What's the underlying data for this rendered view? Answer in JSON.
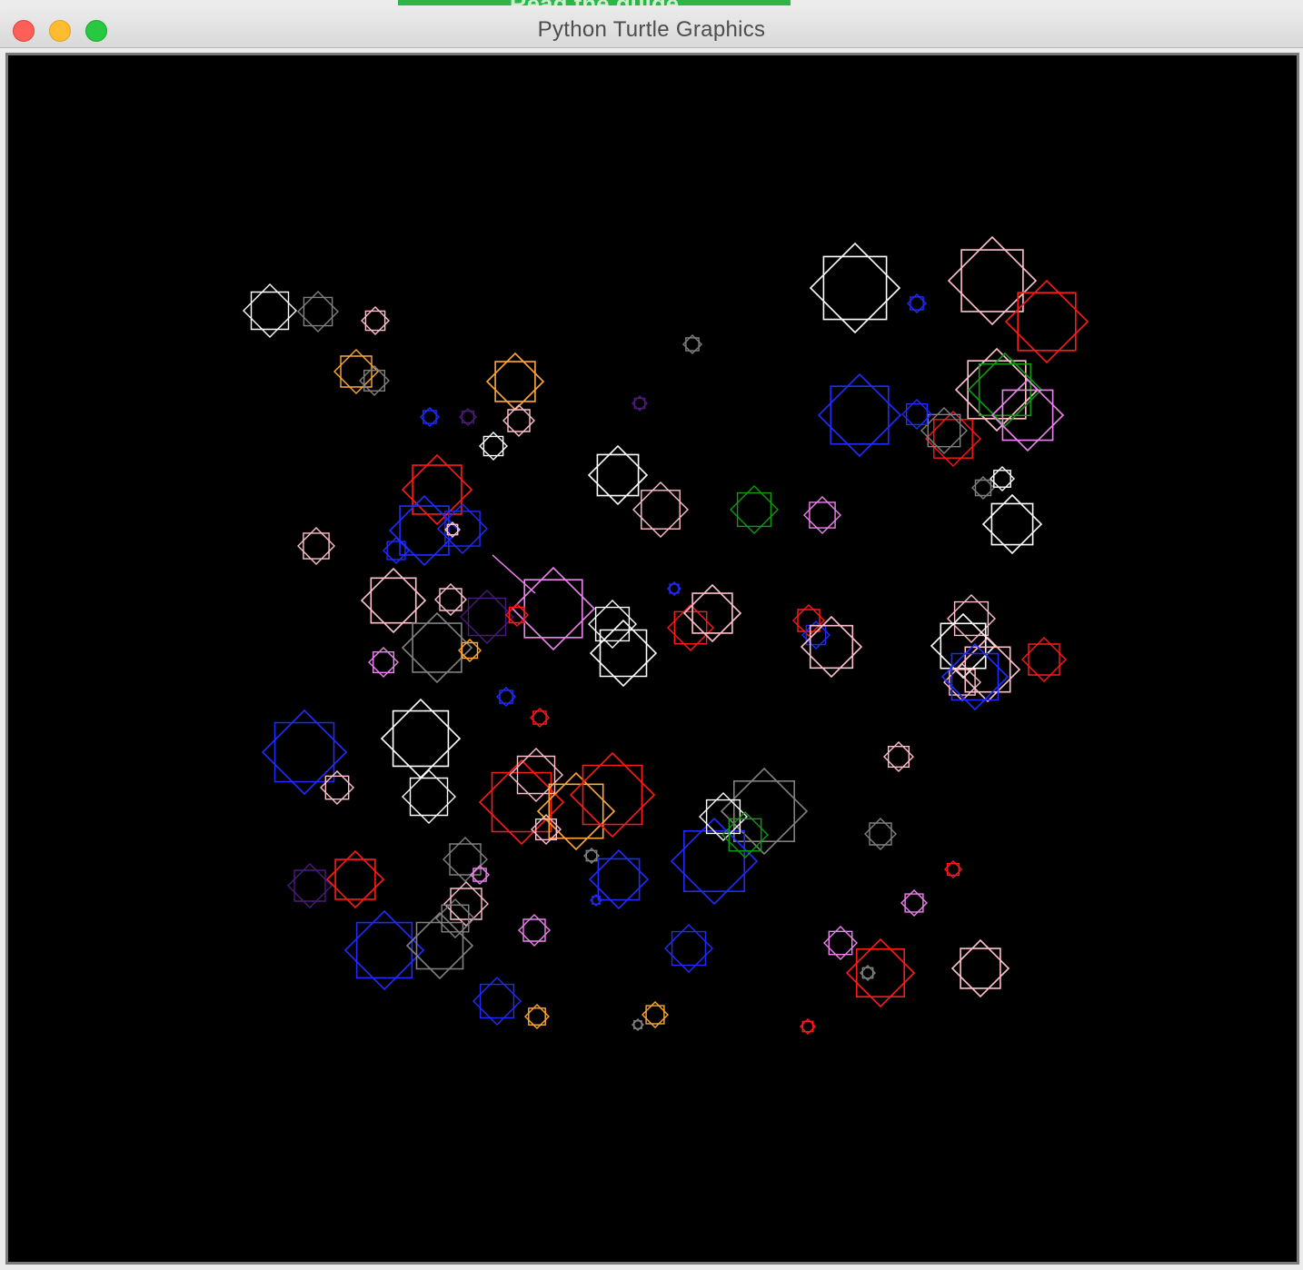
{
  "window": {
    "title": "Python Turtle Graphics",
    "background_tab_label": "Read the guide",
    "controls": [
      "close-button",
      "minimize-button",
      "zoom-button"
    ]
  },
  "canvas": {
    "background": "#000000",
    "shape": "eight-point star (two overlapping squares)"
  },
  "colors": {
    "white": "#ffffff",
    "pink": "#ffc0cb",
    "red": "#ff1a1a",
    "blue": "#1f2bff",
    "gray": "#808080",
    "orange": "#ffa836",
    "green": "#119911",
    "violet": "#ee82ee",
    "indigo": "#4b1a7a"
  }
}
